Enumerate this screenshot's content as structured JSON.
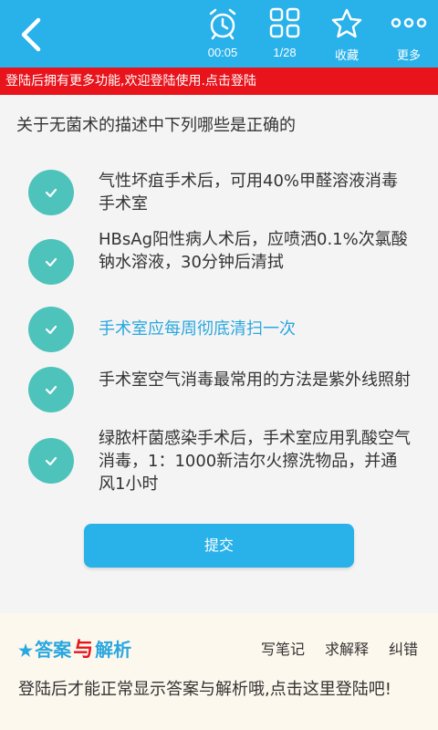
{
  "toolbar": {
    "timer": "00:05",
    "progress": "1/28",
    "favorite": "收藏",
    "more": "更多"
  },
  "login_banner": "登陆后拥有更多功能,欢迎登陆使用.点击登陆",
  "question": "关于无菌术的描述中下列哪些是正确的",
  "options": [
    {
      "text": "气性坏疽手术后，可用40%甲醛溶液消毒手术室",
      "selected": false
    },
    {
      "text": "HBsAg阳性病人术后，应喷洒0.1%次氯酸钠水溶液，30分钟后清拭",
      "selected": false
    },
    {
      "text": "手术室应每周彻底清扫一次",
      "selected": true
    },
    {
      "text": "手术室空气消毒最常用的方法是紫外线照射",
      "selected": false
    },
    {
      "text": "绿脓杆菌感染手术后，手术室应用乳酸空气消毒，1：1000新洁尔火擦洗物品，并通风1小时",
      "selected": false
    }
  ],
  "submit_label": "提交",
  "answer": {
    "title_part1": "答案",
    "title_part2": "与",
    "title_part3": "解析",
    "links": [
      "写笔记",
      "求解释",
      "纠错"
    ],
    "message": "登陆后才能正常显示答案与解析哦,点击这里登陆吧!"
  },
  "colors": {
    "topbar": "#29b1ea",
    "banner": "#e8131b",
    "check": "#4ec3bb",
    "selected_text": "#2aa7df"
  },
  "icons": [
    "back-arrow-icon",
    "alarm-clock-icon",
    "grid-icon",
    "star-icon",
    "more-dots-icon",
    "check-icon"
  ]
}
